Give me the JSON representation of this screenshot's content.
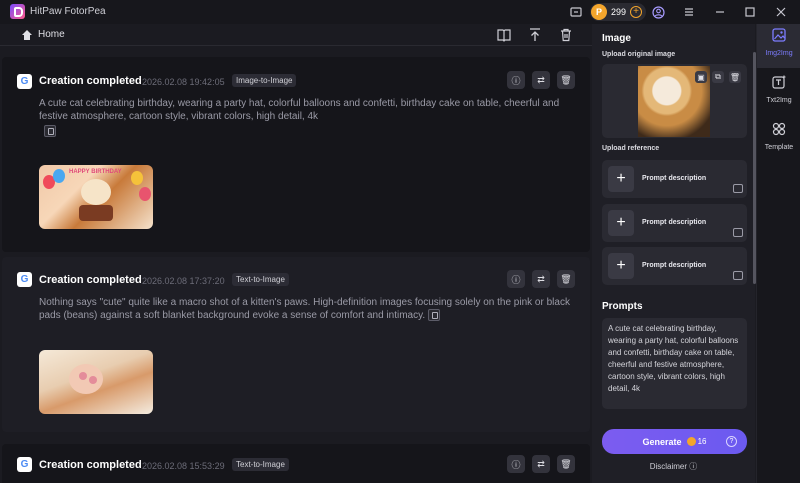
{
  "app": {
    "title": "HitPaw FotorPea",
    "credits": "299",
    "coin_symbol": "P"
  },
  "subbar": {
    "home_label": "Home"
  },
  "cards": [
    {
      "title": "Creation completed",
      "time": "2026.02.08   19:42:05",
      "tag": "Image-to-Image",
      "prompt": "A cute cat celebrating birthday, wearing a party hat, colorful balloons and confetti, birthday cake on table, cheerful and festive atmosphere, cartoon style, vibrant colors, high detail, 4k",
      "image_text": "HAPPY BIRTHDAY"
    },
    {
      "title": "Creation completed",
      "time": "2026.02.08   17:37:20",
      "tag": "Text-to-Image",
      "prompt": "Nothing says \"cute\" quite like a macro shot of a kitten's paws. High-definition images focusing solely on the pink or black pads (beans) against a soft blanket background evoke a sense of comfort and intimacy."
    },
    {
      "title": "Creation completed",
      "time": "2026.02.08   15:53:29",
      "tag": "Text-to-Image"
    }
  ],
  "panel": {
    "heading": "Image",
    "upload_original": "Upload original image",
    "upload_reference": "Upload reference",
    "reference_label": "Prompt description",
    "prompts_heading": "Prompts",
    "prompt_text": "A cute cat celebrating birthday, wearing a party hat, colorful balloons and confetti, birthday cake on table, cheerful and festive atmosphere, cartoon style, vibrant colors, high detail, 4k",
    "generate_label": "Generate",
    "generate_cost": "16",
    "disclaimer": "Disclaimer"
  },
  "nav": [
    {
      "label": "Img2Img",
      "icon": "image-edit-icon"
    },
    {
      "label": "Txt2Img",
      "icon": "text-image-icon"
    },
    {
      "label": "Template",
      "icon": "template-icon"
    }
  ],
  "colors": {
    "accent": "#7c5cf0",
    "coin": "#f3a52c",
    "nav_active": "#7c7cff"
  }
}
